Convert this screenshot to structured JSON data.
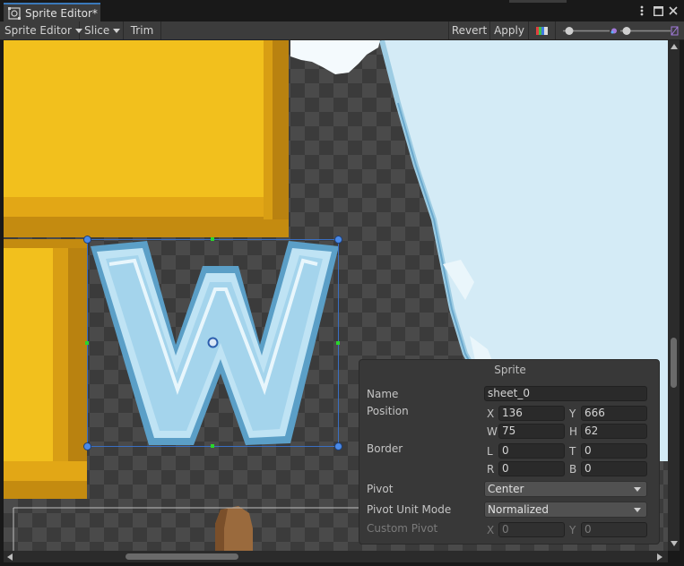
{
  "window": {
    "tab_title": "Sprite Editor*",
    "icons": [
      "sprite-editor-icon",
      "more-options-icon",
      "maximize-icon",
      "close-icon"
    ]
  },
  "toolbar": {
    "sprite_editor_menu": "Sprite Editor",
    "slice_menu": "Slice",
    "trim": "Trim",
    "revert": "Revert",
    "apply": "Apply",
    "icons": [
      "color-channel-icon",
      "zoom-slider",
      "mip-level-slider"
    ]
  },
  "canvas": {
    "colors": {
      "gold": "#f4c21f",
      "ice_blue": "#a8d8ee",
      "frame_blue": "#5fa0c8",
      "sky": "#cfe8f4",
      "handle": "#3a7bd5"
    }
  },
  "sprite_panel": {
    "title": "Sprite",
    "name_label": "Name",
    "name_value": "sheet_0",
    "position_label": "Position",
    "x_label": "X",
    "x_value": "136",
    "y_label": "Y",
    "y_value": "666",
    "w_label": "W",
    "w_value": "75",
    "h_label": "H",
    "h_value": "62",
    "border_label": "Border",
    "l_label": "L",
    "l_value": "0",
    "t_label": "T",
    "t_value": "0",
    "r_label": "R",
    "r_value": "0",
    "b_label": "B",
    "b_value": "0",
    "pivot_label": "Pivot",
    "pivot_value": "Center",
    "pivot_unit_label": "Pivot Unit Mode",
    "pivot_unit_value": "Normalized",
    "custom_pivot_label": "Custom Pivot",
    "cx_label": "X",
    "cx_value": "0",
    "cy_label": "Y",
    "cy_value": "0"
  }
}
